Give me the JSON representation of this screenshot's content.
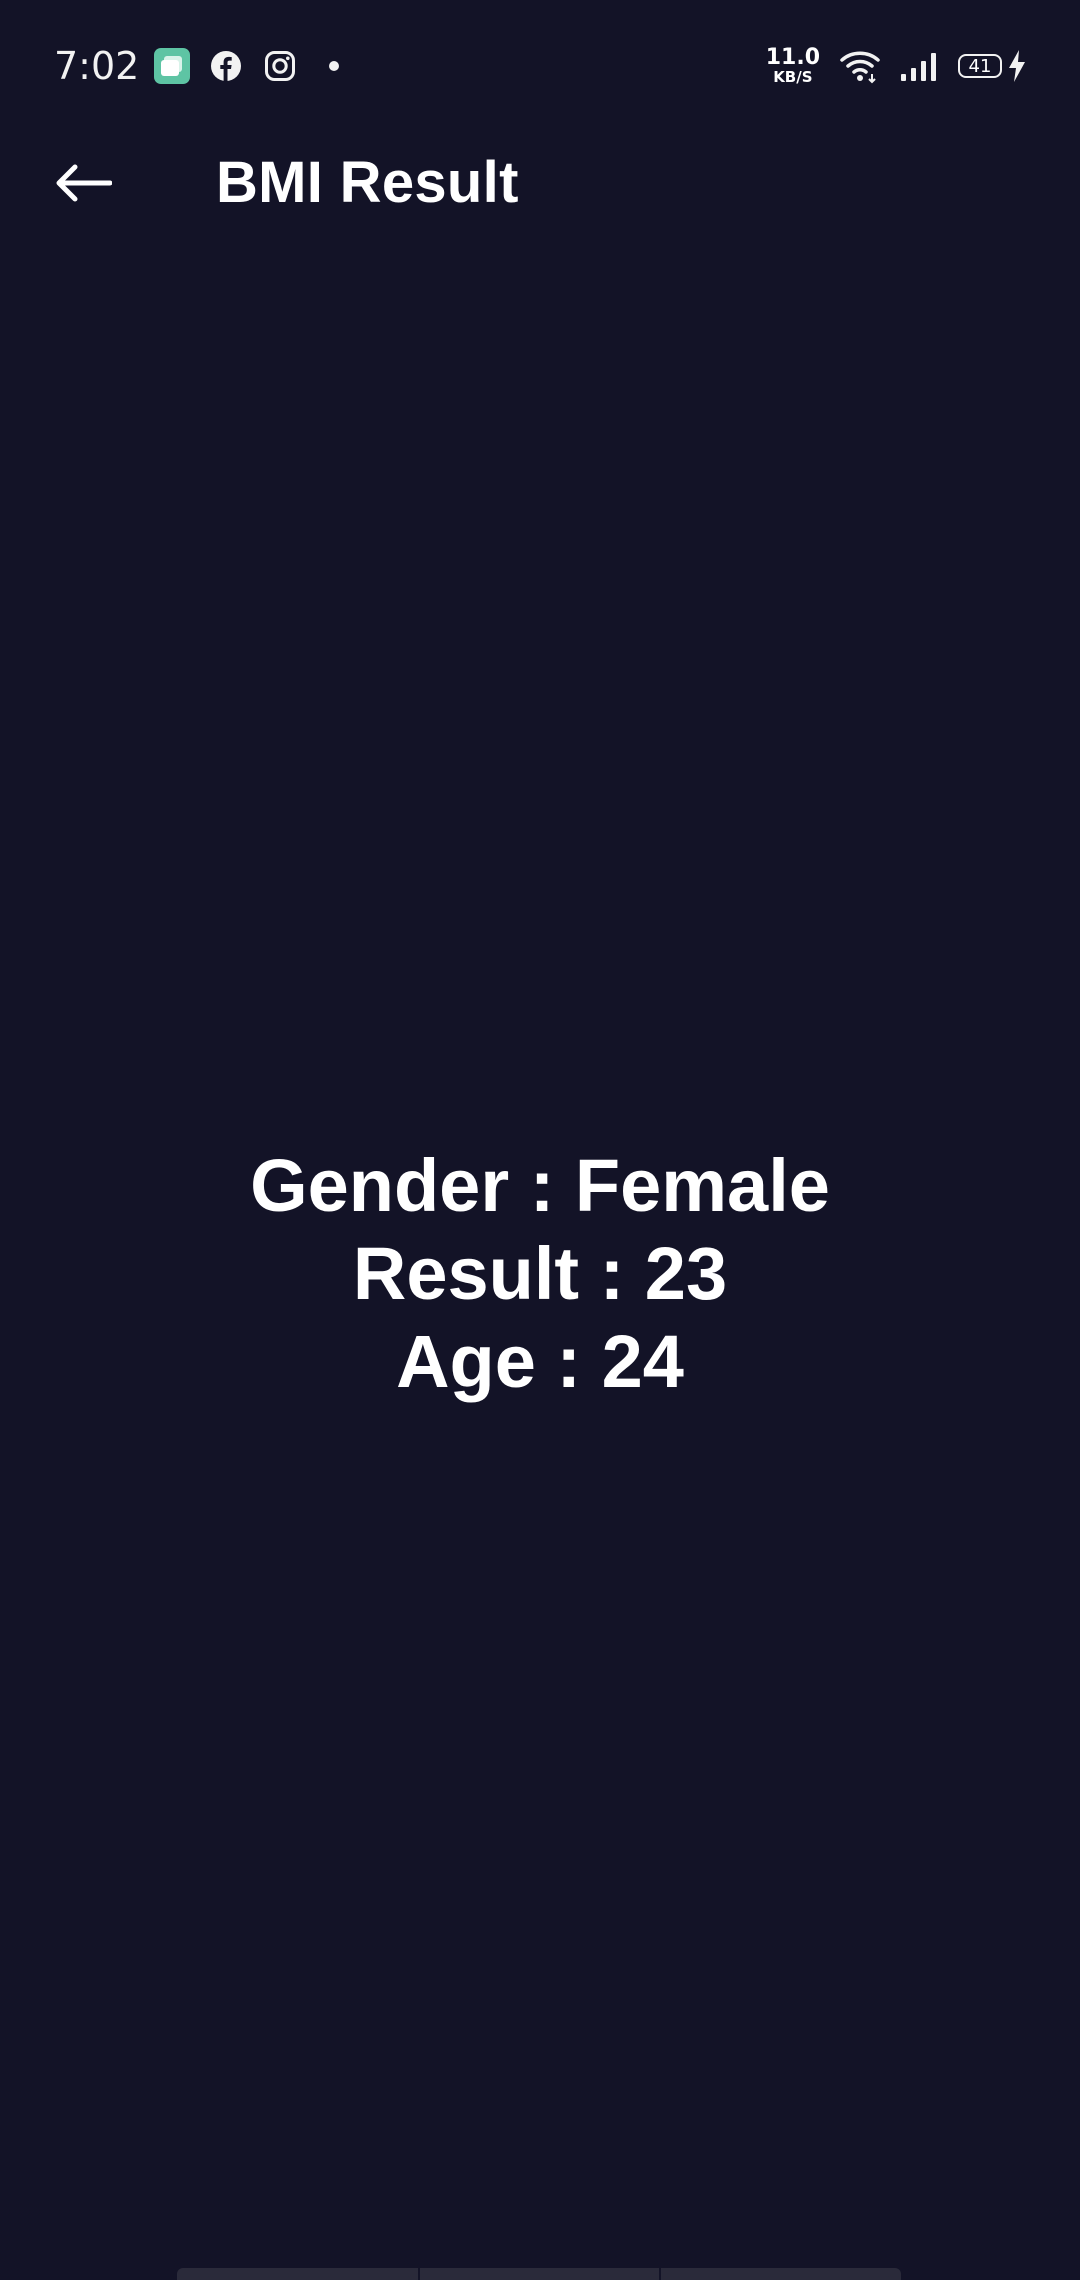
{
  "status_bar": {
    "time": "7:02",
    "net_speed_value": "11.0",
    "net_speed_unit": "KB/S",
    "battery_level": "41",
    "notification_icons": [
      "app-icon",
      "facebook-icon",
      "instagram-icon",
      "dot-icon"
    ]
  },
  "app_bar": {
    "title": "BMI Result",
    "back_icon": "arrow-left-icon"
  },
  "result": {
    "gender_line": "Gender : Female",
    "result_line": "Result : 23",
    "age_line": "Age : 24"
  },
  "colors": {
    "background": "#131327",
    "text": "#ffffff",
    "app_icon_accent": "#5ec4a4"
  }
}
